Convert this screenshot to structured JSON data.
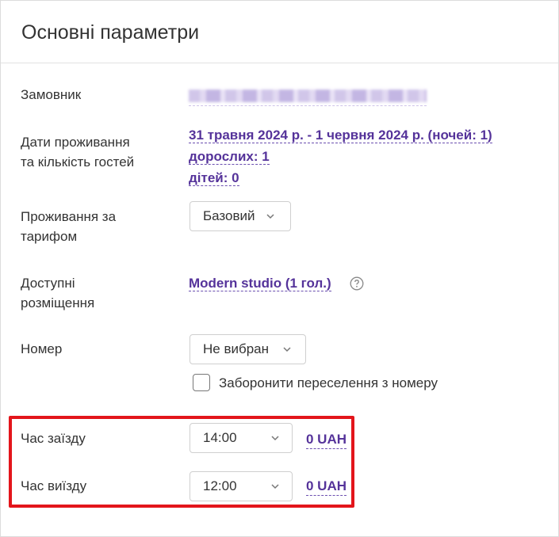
{
  "panel": {
    "title": "Основні параметри"
  },
  "customer": {
    "label": "Замовник",
    "value_redacted": true
  },
  "stay": {
    "label_line1": "Дати проживання",
    "label_line2": "та кількість гостей",
    "dates": "31 травня 2024 р. - 1 червня 2024 р. (ночей: 1)",
    "adults": "дорослих: 1",
    "children": "дітей: 0"
  },
  "tariff": {
    "label_line1": "Проживання за",
    "label_line2": "тарифом",
    "selected": "Базовий"
  },
  "accommodation": {
    "label_line1": "Доступні",
    "label_line2": "розміщення",
    "value": "Modern studio (1 гол.)",
    "help_icon": "question-circle-icon"
  },
  "room": {
    "label": "Номер",
    "selected": "Не вибран",
    "forbid_relocation_label": "Заборонити переселення з номеру",
    "forbid_relocation_checked": false
  },
  "checkin": {
    "label": "Час заїзду",
    "time": "14:00",
    "price": "0 UAH"
  },
  "checkout": {
    "label": "Час виїзду",
    "time": "12:00",
    "price": "0 UAH"
  },
  "colors": {
    "accent": "#55339a",
    "highlight": "#e3151b",
    "border": "#cfcfcf"
  }
}
